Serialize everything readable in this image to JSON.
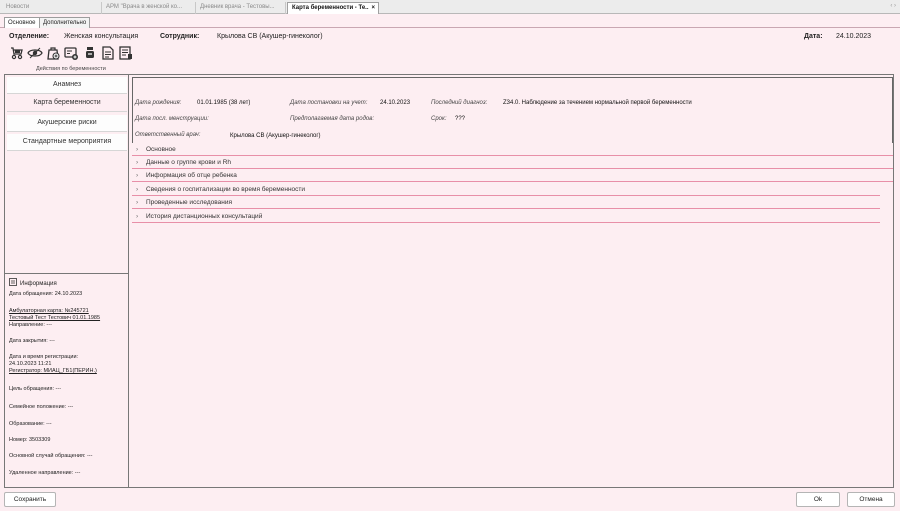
{
  "doc_tabs": [
    {
      "label": "Новости"
    },
    {
      "label": "АРМ \"Врача в женской ко..."
    },
    {
      "label": "Дневник врача - Тестовы..."
    },
    {
      "label": "Карта беременности - Те..",
      "close": "×"
    }
  ],
  "strip_arrows": "‹ ›",
  "sub_tabs": [
    "Основное",
    "Дополнительно"
  ],
  "header": {
    "department_label": "Отделение:",
    "department_value": "Женская консультация",
    "employee_label": "Сотрудник:",
    "employee_value": "Крылова СВ (Акушер-гинеколог)",
    "date_label": "Дата:",
    "date_value": "24.10.2023"
  },
  "toolbar": {
    "caption": "Действия по беременности",
    "icons": [
      "stroller-icon",
      "eye-icon",
      "bag-icon",
      "card-add-icon",
      "bottles-icon",
      "document-icon",
      "document-list-icon"
    ]
  },
  "nav": [
    "Анамнез",
    "Карта беременности",
    "Акушерские риски",
    "Стандартные мероприятия"
  ],
  "info": {
    "title": "Информация",
    "lines": [
      "Дата обращения: 24.10.2023",
      "Амбулаторная карта: №245721",
      "Тестовый Тест Тестович 01.01.1985",
      "Направление: ---",
      "Дата закрытия: ---",
      "Дата и время регистрации:",
      "24.10.2023 11:21",
      "Регистратор: МИАЦ_ГБ1(ПЕРИН.)",
      "Цель обращения: ---",
      "Семейное положение: ---",
      "Образование: ---",
      "Номер: 3503309",
      "Основной случай обращения: ---",
      "Удаленное направление: ---"
    ]
  },
  "patient": {
    "birth_label": "Дата рождения:",
    "birth_value": "01.01.1985 (38 лет)",
    "reg_label": "Дата постановки на учет:",
    "reg_value": "24.10.2023",
    "diag_label": "Последний диагноз:",
    "diag_value": "Z34.0. Наблюдение за течением нормальной первой беременности",
    "mens_label": "Дата посл. менструации:",
    "birthdate_label": "Предполагаемая дата родов:",
    "term_label": "Срок:",
    "term_value": "???",
    "doctor_label": "Ответственный врач:",
    "doctor_value": "Крылова СВ (Акушер-гинеколог)"
  },
  "sections": [
    "Основное",
    "Данные о группе крови и Rh",
    "Информация об отце ребенка",
    "Сведения о госпитализации во время беременности",
    "Проведенные исследования",
    "История дистанционных консультаций"
  ],
  "buttons": {
    "save": "Сохранить",
    "ok": "Ok",
    "cancel": "Отмена"
  }
}
